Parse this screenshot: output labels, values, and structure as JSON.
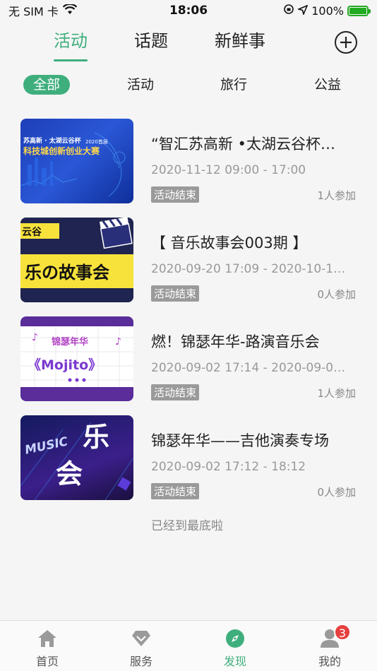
{
  "status_bar": {
    "carrier": "无 SIM 卡",
    "time": "18:06",
    "battery_percent": "100%",
    "battery_level": 1.0
  },
  "top_tabs": [
    {
      "label": "活动",
      "active": true
    },
    {
      "label": "话题",
      "active": false
    },
    {
      "label": "新鲜事",
      "active": false
    }
  ],
  "filters": [
    {
      "label": "全部",
      "active": true
    },
    {
      "label": "活动",
      "active": false
    },
    {
      "label": "旅行",
      "active": false
    },
    {
      "label": "公益",
      "active": false
    }
  ],
  "events": [
    {
      "title": "“智汇苏高新 •太湖云谷杯…",
      "date": "2020-11-12 09:00 - 17:00",
      "status": "活动结束",
      "participants": "1人参加",
      "thumb_text": [
        "苏高新 · 太湖云谷杯",
        "2020首届",
        "科技城创新创业大赛"
      ]
    },
    {
      "title": "【 音乐故事会003期 】",
      "date": "2020-09-20 17:09 - 2020-10-1…",
      "status": "活动结束",
      "participants": "0人参加",
      "thumb_text": [
        "云谷",
        "乐の故事会"
      ]
    },
    {
      "title": "燃！锦瑟年华-路演音乐会",
      "date": "2020-09-02 17:14 - 2020-09-0…",
      "status": "活动结束",
      "participants": "1人参加",
      "thumb_text": [
        "锦瑟年华",
        "《Mojito》"
      ]
    },
    {
      "title": "锦瑟年华——吉他演奏专场",
      "date": "2020-09-02 17:12 - 18:12",
      "status": "活动结束",
      "participants": "0人参加",
      "thumb_text": [
        "MUSIC",
        "乐",
        "会"
      ]
    }
  ],
  "end_text": "已经到最底啦",
  "bottom_nav": [
    {
      "label": "首页",
      "icon": "home-icon"
    },
    {
      "label": "服务",
      "icon": "diamond-icon"
    },
    {
      "label": "发现",
      "icon": "compass-icon",
      "active": true
    },
    {
      "label": "我的",
      "icon": "user-icon",
      "badge": "3"
    }
  ],
  "colors": {
    "accent": "#3fae7d",
    "badge_red": "#e5403f",
    "ended_badge": "#9a9a9a"
  }
}
